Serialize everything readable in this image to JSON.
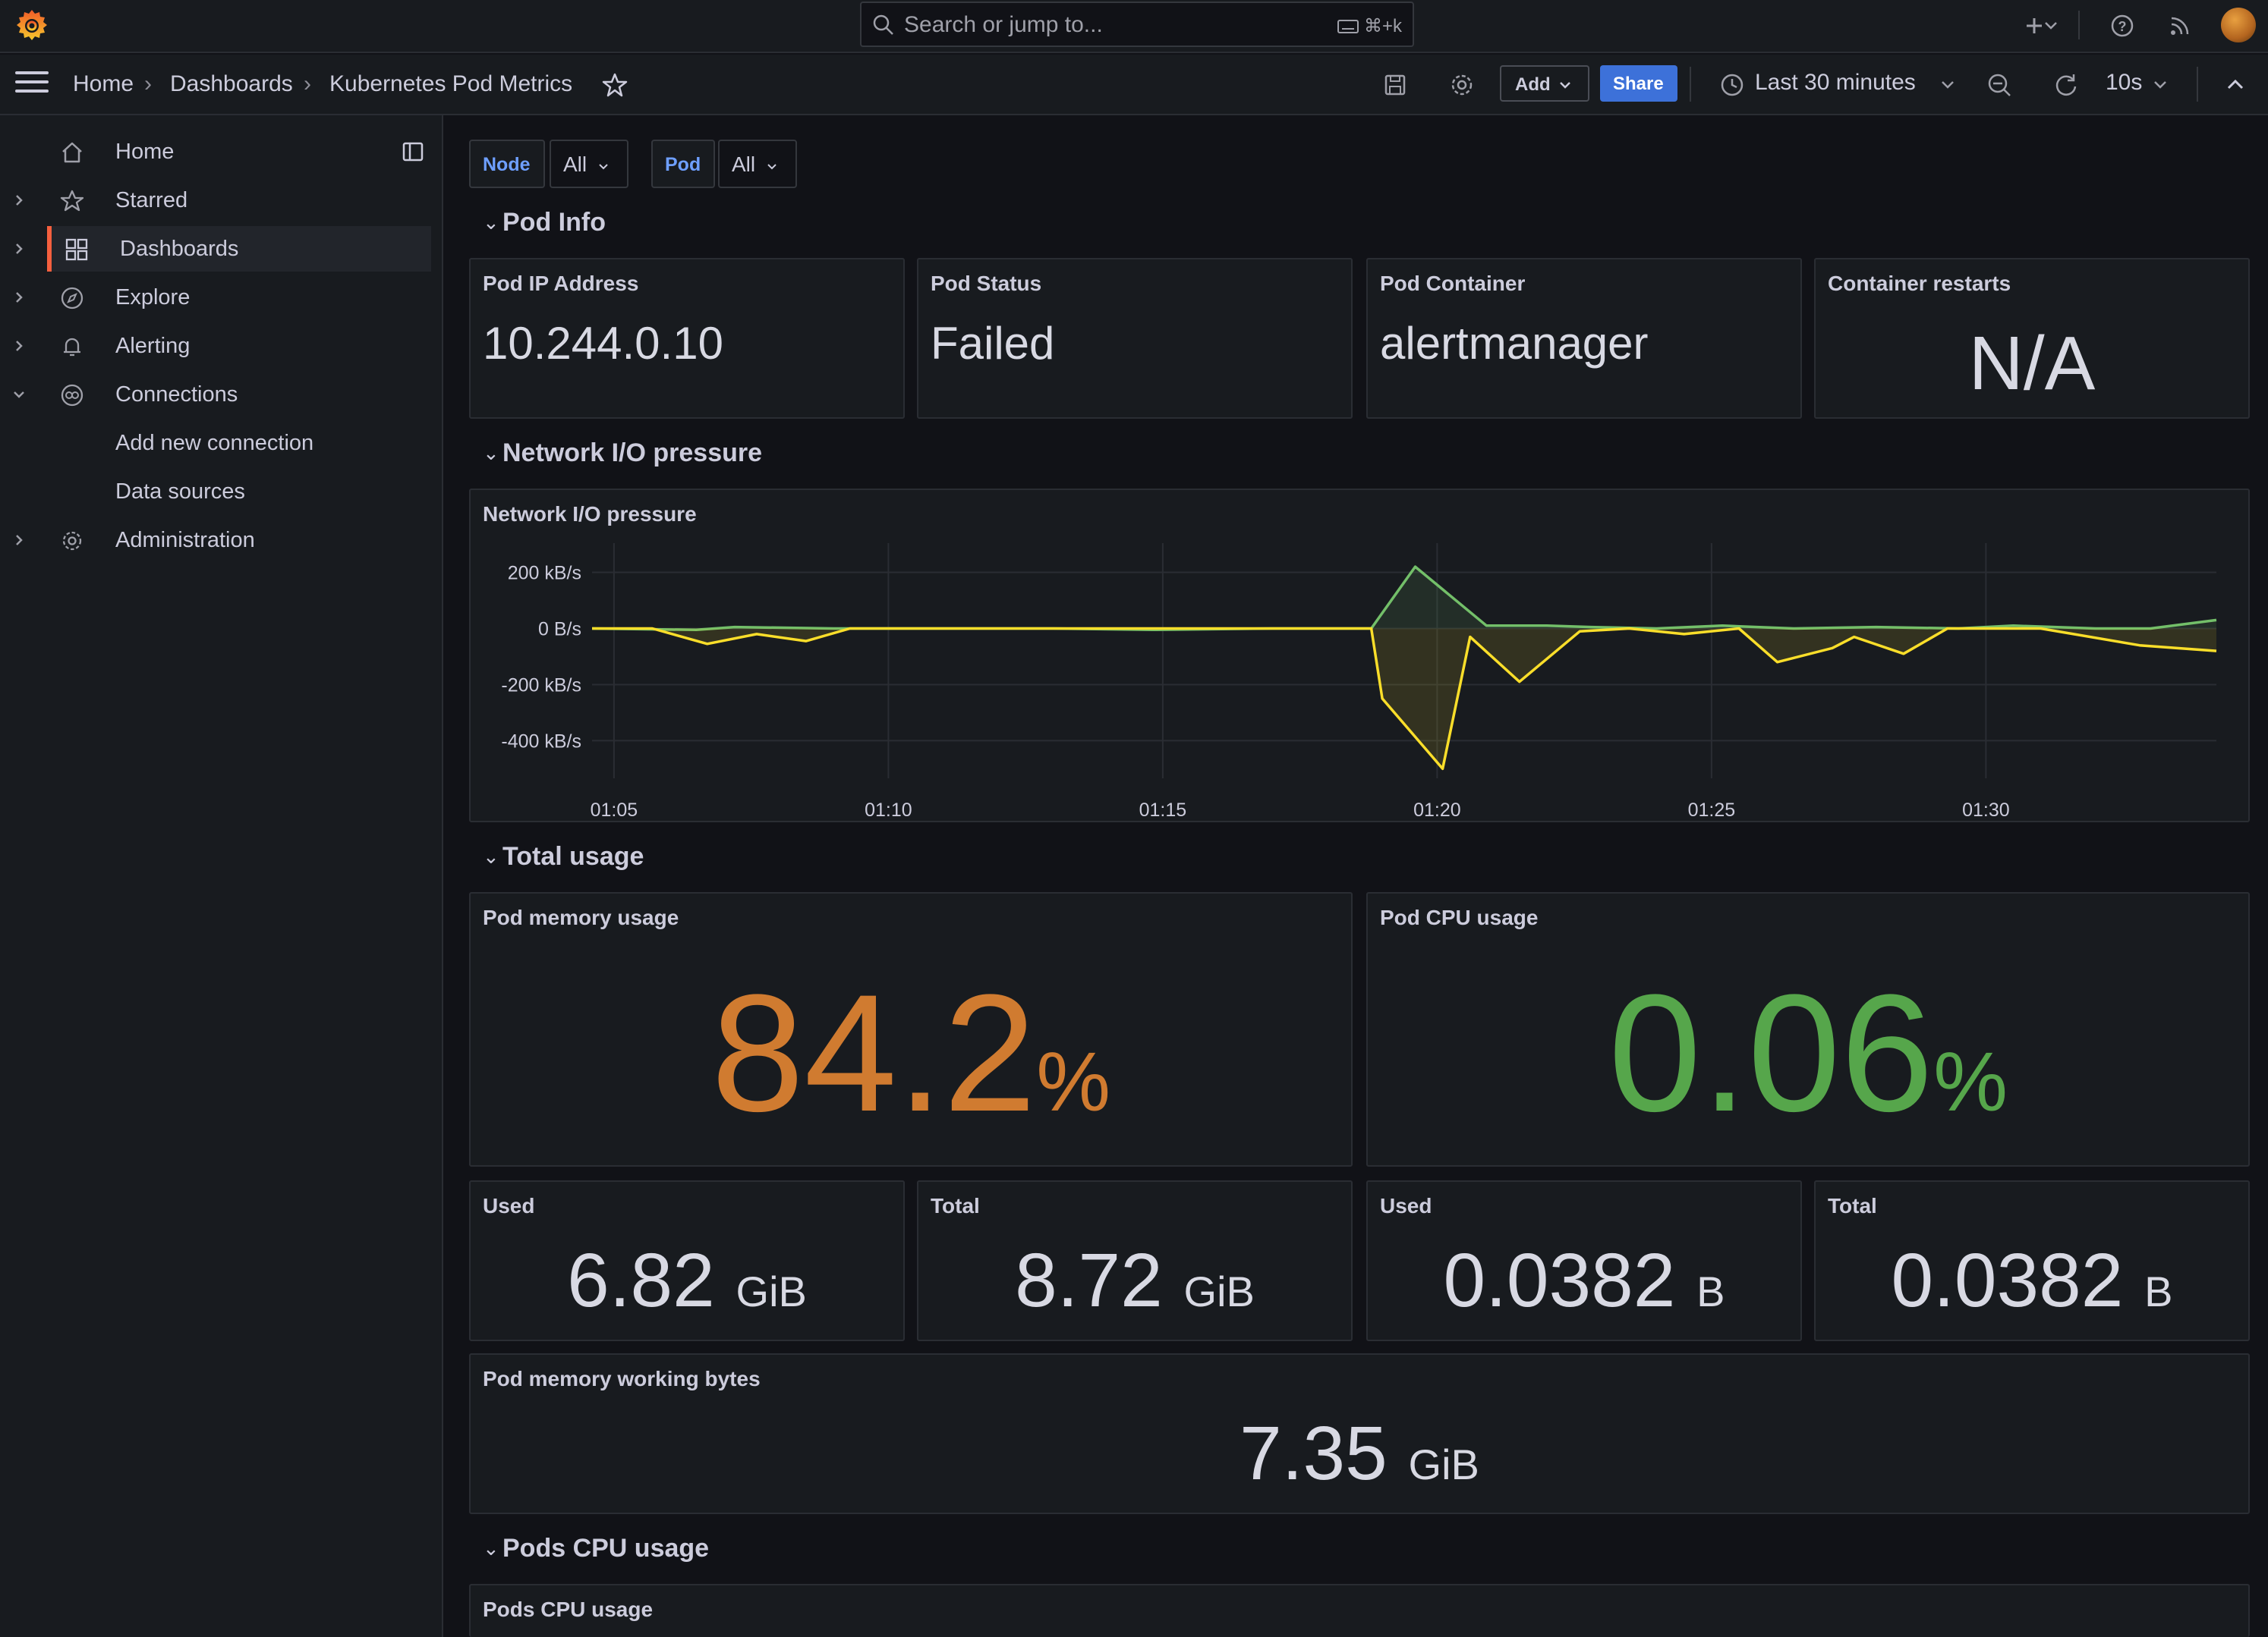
{
  "topbar": {
    "search_placeholder": "Search or jump to...",
    "search_shortcut": "⌘+k"
  },
  "breadcrumb": {
    "items": [
      "Home",
      "Dashboards",
      "Kubernetes Pod Metrics"
    ]
  },
  "toolbar": {
    "add_label": "Add",
    "share_label": "Share",
    "time_range": "Last 30 minutes",
    "refresh_interval": "10s"
  },
  "sidebar": {
    "items": [
      {
        "label": "Home",
        "icon": "home-icon"
      },
      {
        "label": "Starred",
        "icon": "star-icon"
      },
      {
        "label": "Dashboards",
        "icon": "dashboards-grid-icon",
        "active": true
      },
      {
        "label": "Explore",
        "icon": "compass-icon"
      },
      {
        "label": "Alerting",
        "icon": "bell-icon"
      },
      {
        "label": "Connections",
        "icon": "connections-icon"
      },
      {
        "label": "Administration",
        "icon": "gear-icon"
      }
    ],
    "connections_children": [
      "Add new connection",
      "Data sources"
    ]
  },
  "variables": [
    {
      "label": "Node",
      "value": "All"
    },
    {
      "label": "Pod",
      "value": "All"
    }
  ],
  "rows": {
    "pod_info": "Pod Info",
    "network": "Network I/O pressure",
    "total_usage": "Total usage",
    "pods_cpu": "Pods CPU usage"
  },
  "pod_info": {
    "ip": {
      "title": "Pod IP Address",
      "value": "10.244.0.10"
    },
    "status": {
      "title": "Pod Status",
      "value": "Failed"
    },
    "container": {
      "title": "Pod Container",
      "value": "alertmanager"
    },
    "restarts": {
      "title": "Container restarts",
      "value": "N/A"
    }
  },
  "network_panel": {
    "title": "Network I/O pressure"
  },
  "chart_data": {
    "type": "line",
    "title": "Network I/O pressure",
    "xlabel": "",
    "ylabel": "",
    "x_ticks": [
      "01:05",
      "01:10",
      "01:15",
      "01:20",
      "01:25",
      "01:30"
    ],
    "y_ticks": [
      "200 kB/s",
      "0 B/s",
      "-200 kB/s",
      "-400 kB/s"
    ],
    "ylim": [
      -480,
      250
    ],
    "x_range_min": [
      64.6,
      94.2
    ],
    "grid": true,
    "series": [
      {
        "color": "#73bf69",
        "points": [
          [
            64.6,
            0
          ],
          [
            66.5,
            -5
          ],
          [
            67.2,
            5
          ],
          [
            69,
            0
          ],
          [
            73,
            0
          ],
          [
            74.8,
            -5
          ],
          [
            77,
            0
          ],
          [
            78.8,
            0
          ],
          [
            79.6,
            220
          ],
          [
            80.9,
            10
          ],
          [
            82,
            10
          ],
          [
            82.8,
            5
          ],
          [
            84,
            0
          ],
          [
            85.2,
            10
          ],
          [
            86.5,
            0
          ],
          [
            88,
            5
          ],
          [
            89.5,
            0
          ],
          [
            90.5,
            10
          ],
          [
            92,
            0
          ],
          [
            93,
            0
          ],
          [
            94.2,
            30
          ]
        ],
        "fill": false
      },
      {
        "color": "#fade2a",
        "points": [
          [
            64.6,
            0
          ],
          [
            65.7,
            0
          ],
          [
            66.7,
            -55
          ],
          [
            67.6,
            -20
          ],
          [
            68.5,
            -45
          ],
          [
            69.3,
            0
          ],
          [
            73,
            0
          ],
          [
            77,
            0
          ],
          [
            78.8,
            0
          ],
          [
            79.0,
            -250
          ],
          [
            80.1,
            -500
          ],
          [
            80.6,
            -30
          ],
          [
            81.5,
            -190
          ],
          [
            82.6,
            -10
          ],
          [
            83.5,
            0
          ],
          [
            84.5,
            -20
          ],
          [
            85.5,
            0
          ],
          [
            86.2,
            -120
          ],
          [
            87.2,
            -70
          ],
          [
            87.6,
            -30
          ],
          [
            88.5,
            -90
          ],
          [
            89.3,
            0
          ],
          [
            91,
            0
          ],
          [
            92.8,
            -60
          ],
          [
            94.2,
            -80
          ]
        ],
        "fill": true
      }
    ]
  },
  "total_usage": {
    "memory": {
      "title": "Pod memory usage",
      "value": "84.2",
      "unit": "%",
      "color": "#d07b30"
    },
    "cpu": {
      "title": "Pod CPU usage",
      "value": "0.06",
      "unit": "%",
      "color": "#56a64b"
    },
    "mem_used": {
      "title": "Used",
      "value": "6.82",
      "unit": "GiB"
    },
    "mem_total": {
      "title": "Total",
      "value": "8.72",
      "unit": "GiB"
    },
    "cpu_used": {
      "title": "Used",
      "value": "0.0382",
      "unit": "B"
    },
    "cpu_total": {
      "title": "Total",
      "value": "0.0382",
      "unit": "B"
    },
    "working": {
      "title": "Pod memory working bytes",
      "value": "7.35",
      "unit": "GiB"
    }
  },
  "pods_cpu_panel": {
    "title": "Pods CPU usage"
  }
}
